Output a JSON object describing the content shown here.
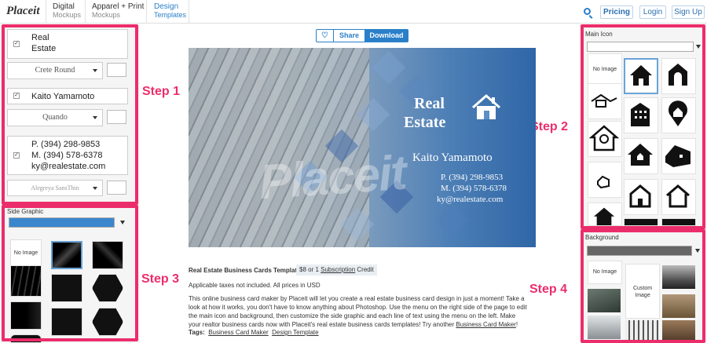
{
  "topbar": {
    "logo": "Placeit",
    "tabs": [
      {
        "label": "Digital",
        "sub": "Mockups"
      },
      {
        "label": "Apparel + Print",
        "sub": "Mockups"
      },
      {
        "label": "Design",
        "sub": "Templates"
      }
    ],
    "buttons": {
      "pricing": "Pricing",
      "login": "Login",
      "signup": "Sign Up"
    }
  },
  "left": {
    "line1": {
      "line_a": "Real",
      "line_b": "Estate",
      "font": "Crete Round"
    },
    "line2": {
      "text": "Kaito Yamamoto",
      "font": "Quando"
    },
    "line3": {
      "phone": "P. (394) 298-9853",
      "mobile": "M. (394) 578-6378",
      "email": "ky@realestate.com",
      "font": "Alegreya SansThin"
    },
    "side_graphic_label": "Side Graphic",
    "side_graphic_color": "#3b86cc",
    "no_image": "No Image"
  },
  "steps": {
    "s1": "Step 1",
    "s2": "Step 2",
    "s3": "Step 3",
    "s4": "Step 4"
  },
  "actions": {
    "share": "Share",
    "download": "Download"
  },
  "card": {
    "title_a": "Real",
    "title_b": "Estate",
    "name": "Kaito Yamamoto",
    "phone": "P. (394) 298-9853",
    "mobile": "M. (394) 578-6378",
    "email": "ky@realestate.com",
    "watermark": "Placeit"
  },
  "info": {
    "title": "Real Estate Business Cards Templates",
    "price_a": "$8 or 1",
    "price_link": "Subscription",
    "price_b": "Credit",
    "taxes": "Applicable taxes not included. All prices in USD",
    "desc": "This online business card maker by Placeit will let you create a real estate business card design in just a moment! Take a look at how it works, you don't have to know anything about Photoshop. Use the menu on the right side of the page to edit the main icon and background, then customize the side graphic and each line of text using the menu on the left. Make your realtor business cards now with Placeit's real estate business cards templates! Try another",
    "desc_link": "Business Card Maker",
    "desc_end": "!",
    "tags_label": "Tags:",
    "tag1": "Business Card Maker",
    "tag2": "Design Template"
  },
  "right": {
    "main_icon_label": "Main Icon",
    "no_image": "No Image",
    "background_label": "Background",
    "background_color": "#666666",
    "custom_image": "Custom Image"
  },
  "colors": {
    "accent": "#2a7fc9",
    "highlight": "#ec2d6b"
  }
}
